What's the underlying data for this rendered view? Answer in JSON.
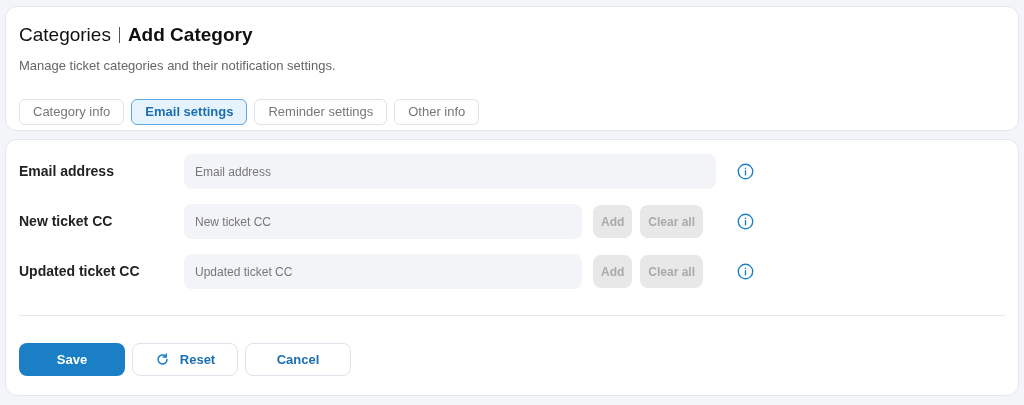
{
  "header": {
    "title": "Categories",
    "subtitle_title": "Add Category",
    "description": "Manage ticket categories and their notification settings."
  },
  "tabs": [
    {
      "label": "Category info",
      "selected": false
    },
    {
      "label": "Email settings",
      "selected": true
    },
    {
      "label": "Reminder settings",
      "selected": false
    },
    {
      "label": "Other info",
      "selected": false
    }
  ],
  "fields": [
    {
      "label": "Email address",
      "placeholder": "Email address",
      "kind": "single"
    },
    {
      "label": "New ticket CC",
      "placeholder": "New ticket CC",
      "kind": "list",
      "buttons": [
        {
          "label": "Add",
          "disabled": true
        },
        {
          "label": "Clear all",
          "disabled": true
        }
      ]
    },
    {
      "label": "Updated ticket CC",
      "placeholder": "Updated ticket CC",
      "kind": "list",
      "buttons": [
        {
          "label": "Add",
          "disabled": true
        },
        {
          "label": "Clear all",
          "disabled": true
        }
      ]
    }
  ],
  "actions": [
    {
      "label": "Save",
      "kind": "primary"
    },
    {
      "label": "Reset",
      "kind": "reset"
    },
    {
      "label": "Cancel",
      "kind": "secondary"
    }
  ]
}
